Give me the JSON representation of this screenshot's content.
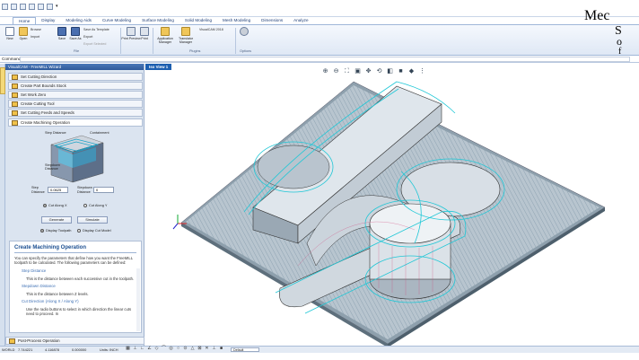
{
  "quick_access_toolbar": {
    "icons": [
      "app-menu-icon",
      "new-icon",
      "open-icon",
      "save-icon",
      "undo-icon",
      "redo-icon",
      "dropdown-icon"
    ]
  },
  "ribbon": {
    "tabs": [
      "Home",
      "Display",
      "Modeling Aids",
      "Curve Modeling",
      "Surface Modeling",
      "Solid Modeling",
      "Mesh Modeling",
      "Dimensions",
      "Analyze"
    ],
    "active_tab": "Home",
    "buttons": {
      "new": "New",
      "open": "Open",
      "browse": "Browse",
      "import": "Import",
      "save": "Save",
      "save_as": "Save As",
      "save_as_template": "Save As Template",
      "export": "Export",
      "export_selected": "Export Selected",
      "print_preview": "Print Preview",
      "print": "Print",
      "application_manager": "Application Manager",
      "translator_manager": "Translator Manager",
      "visualcam": "VisualCAM 2018"
    },
    "groups": [
      "File",
      "Plugins",
      "Options"
    ]
  },
  "command": {
    "label": "Command"
  },
  "wizard": {
    "title": "VisualCAM - FreeMILL Wizard",
    "steps": [
      "Set Cutting Direction",
      "Create Part Bounds Stock",
      "Set Work Zero",
      "Create Cutting Tool",
      "Set Cutting Feeds and Speeds",
      "Create Machining Operation"
    ],
    "selected_step_index": 5,
    "illustration_labels": {
      "step": "Step Distance",
      "containment": "Containment",
      "stepdown": "Stepdown Distance"
    },
    "step_distance": {
      "label": "Step Distance",
      "value": "0.0625"
    },
    "stepdown_distance": {
      "label": "Stepdown Distance",
      "value": "0"
    },
    "cut_along_x": "Cut Along X",
    "cut_along_y": "Cut Along Y",
    "generate": "Generate",
    "simulate": "Simulate",
    "display_toolpath": "Display Toolpath",
    "display_cut_model": "Display Cut Model"
  },
  "help": {
    "title": "Create Machining Operation",
    "intro": "You can specify the parameters that define how you want the FreeMILL toolpath to be calculated. The following parameters can be defined:",
    "items": [
      {
        "term": "Step Distance",
        "def": "This is the distance between each successive cut in the toolpath."
      },
      {
        "term": "Stepdown Distance",
        "def": "This is the distance between Z levels."
      },
      {
        "term": "Cut Direction (Along X / Along Y)",
        "def": "Use the radio buttons to select in which direction the linear cuts need to proceed. In"
      }
    ]
  },
  "post_process": "Post-Process Operation",
  "viewport": {
    "tab": "Iso View 1"
  },
  "status": {
    "world": "WORLD",
    "x": "7.744221",
    "y": "4.116878",
    "z": "0.000000",
    "units": "Units: INCH",
    "layer": "Default"
  },
  "logo": "MecSoft"
}
